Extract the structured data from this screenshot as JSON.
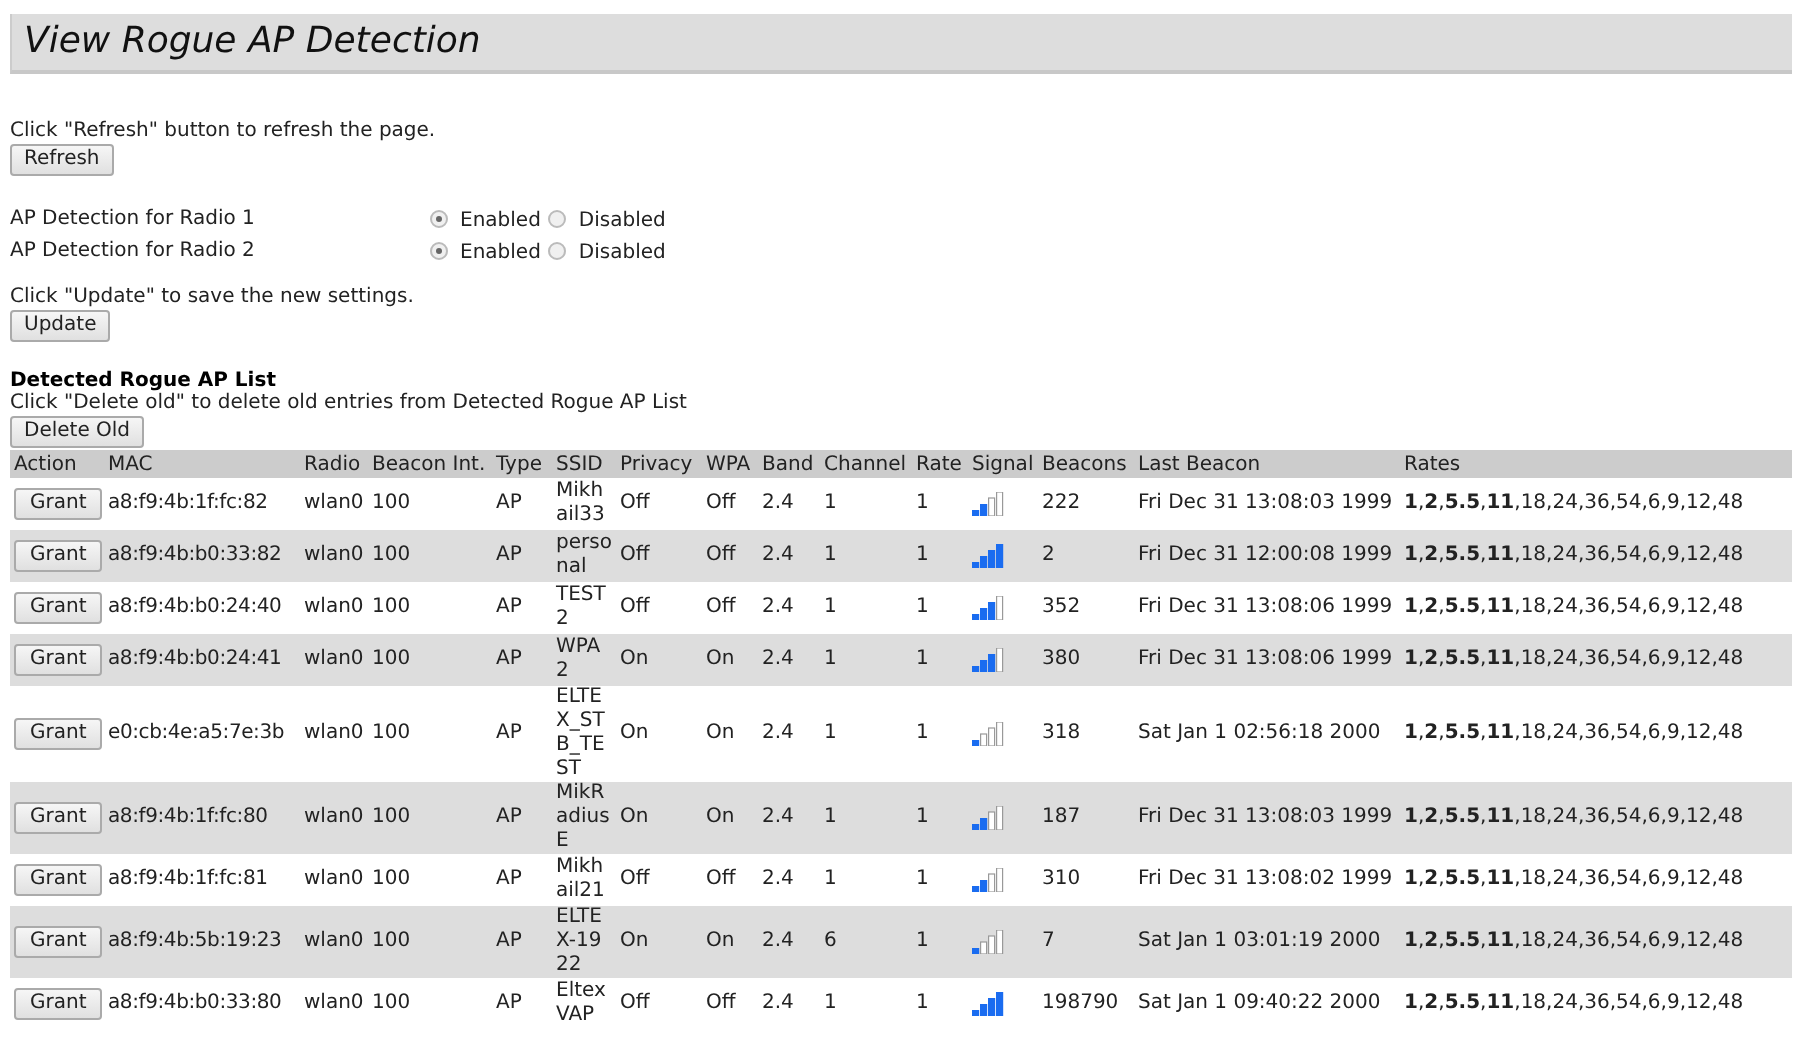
{
  "title": "View Rogue AP Detection",
  "refresh_hint": "Click \"Refresh\" button to refresh the page.",
  "refresh_button": "Refresh",
  "detection": [
    {
      "label": "AP Detection for Radio 1",
      "options": [
        {
          "label": "Enabled",
          "selected": true
        },
        {
          "label": "Disabled",
          "selected": false
        }
      ]
    },
    {
      "label": "AP Detection for Radio 2",
      "options": [
        {
          "label": "Enabled",
          "selected": true
        },
        {
          "label": "Disabled",
          "selected": false
        }
      ]
    }
  ],
  "update_hint": "Click \"Update\" to save the new settings.",
  "update_button": "Update",
  "list_title": "Detected Rogue AP List",
  "delete_hint": "Click \"Delete old\" to delete old entries from Detected Rogue AP List",
  "delete_button": "Delete Old",
  "table": {
    "columns": [
      "Action",
      "MAC",
      "Radio",
      "Beacon Int.",
      "Type",
      "SSID",
      "Privacy",
      "WPA",
      "Band",
      "Channel",
      "Rate",
      "Signal",
      "Beacons",
      "Last Beacon",
      "Rates"
    ],
    "rows": [
      {
        "action": "Grant",
        "mac": "a8:f9:4b:1f:fc:82",
        "radio": "wlan0",
        "beacon_int": "100",
        "type": "AP",
        "ssid": "Mikhail33",
        "privacy": "Off",
        "wpa": "Off",
        "band": "2.4",
        "channel": "1",
        "rate": "1",
        "signal": {
          "level": 0.5
        },
        "beacons": "222",
        "last_beacon": "Fri Dec 31 13:08:03 1999",
        "rates": "**1**,**2**,**5.5**,**11**,18,24,36,54,6,9,12,48"
      },
      {
        "action": "Grant",
        "mac": "a8:f9:4b:b0:33:82",
        "radio": "wlan0",
        "beacon_int": "100",
        "type": "AP",
        "ssid": "personal",
        "privacy": "Off",
        "wpa": "Off",
        "band": "2.4",
        "channel": "1",
        "rate": "1",
        "signal": {
          "level": 1
        },
        "beacons": "2",
        "last_beacon": "Fri Dec 31 12:00:08 1999",
        "rates": "**1**,**2**,**5.5**,**11**,18,24,36,54,6,9,12,48"
      },
      {
        "action": "Grant",
        "mac": "a8:f9:4b:b0:24:40",
        "radio": "wlan0",
        "beacon_int": "100",
        "type": "AP",
        "ssid": "TEST2",
        "privacy": "Off",
        "wpa": "Off",
        "band": "2.4",
        "channel": "1",
        "rate": "1",
        "signal": {
          "level": 0.75
        },
        "beacons": "352",
        "last_beacon": "Fri Dec 31 13:08:06 1999",
        "rates": "**1**,**2**,**5.5**,**11**,18,24,36,54,6,9,12,48"
      },
      {
        "action": "Grant",
        "mac": "a8:f9:4b:b0:24:41",
        "radio": "wlan0",
        "beacon_int": "100",
        "type": "AP",
        "ssid": "WPA2",
        "privacy": "On",
        "wpa": "On",
        "band": "2.4",
        "channel": "1",
        "rate": "1",
        "signal": {
          "level": 0.75
        },
        "beacons": "380",
        "last_beacon": "Fri Dec 31 13:08:06 1999",
        "rates": "**1**,**2**,**5.5**,**11**,18,24,36,54,6,9,12,48"
      },
      {
        "action": "Grant",
        "mac": "e0:cb:4e:a5:7e:3b",
        "radio": "wlan0",
        "beacon_int": "100",
        "type": "AP",
        "ssid": "ELTEX_STB_TEST",
        "privacy": "On",
        "wpa": "On",
        "band": "2.4",
        "channel": "1",
        "rate": "1",
        "signal": {
          "level": 0.25
        },
        "beacons": "318",
        "last_beacon": "Sat Jan 1 02:56:18 2000",
        "rates": "**1**,**2**,**5.5**,**11**,18,24,36,54,6,9,12,48"
      },
      {
        "action": "Grant",
        "mac": "a8:f9:4b:1f:fc:80",
        "radio": "wlan0",
        "beacon_int": "100",
        "type": "AP",
        "ssid": "MikRadiusE",
        "privacy": "On",
        "wpa": "On",
        "band": "2.4",
        "channel": "1",
        "rate": "1",
        "signal": {
          "level": 0.5
        },
        "beacons": "187",
        "last_beacon": "Fri Dec 31 13:08:03 1999",
        "rates": "**1**,**2**,**5.5**,**11**,18,24,36,54,6,9,12,48"
      },
      {
        "action": "Grant",
        "mac": "a8:f9:4b:1f:fc:81",
        "radio": "wlan0",
        "beacon_int": "100",
        "type": "AP",
        "ssid": "Mikhail21",
        "privacy": "Off",
        "wpa": "Off",
        "band": "2.4",
        "channel": "1",
        "rate": "1",
        "signal": {
          "level": 0.5
        },
        "beacons": "310",
        "last_beacon": "Fri Dec 31 13:08:02 1999",
        "rates": "**1**,**2**,**5.5**,**11**,18,24,36,54,6,9,12,48"
      },
      {
        "action": "Grant",
        "mac": "a8:f9:4b:5b:19:23",
        "radio": "wlan0",
        "beacon_int": "100",
        "type": "AP",
        "ssid": "ELTEX-1922",
        "privacy": "On",
        "wpa": "On",
        "band": "2.4",
        "channel": "6",
        "rate": "1",
        "signal": {
          "level": 0.25
        },
        "beacons": "7",
        "last_beacon": "Sat Jan 1 03:01:19 2000",
        "rates": "**1**,**2**,**5.5**,**11**,18,24,36,54,6,9,12,48"
      },
      {
        "action": "Grant",
        "mac": "a8:f9:4b:b0:33:80",
        "radio": "wlan0",
        "beacon_int": "100",
        "type": "AP",
        "ssid": "Eltex VAP",
        "privacy": "Off",
        "wpa": "Off",
        "band": "2.4",
        "channel": "1",
        "rate": "1",
        "signal": {
          "level": 1
        },
        "beacons": "198790",
        "last_beacon": "Sat Jan 1 09:40:22 2000",
        "rates": "**1**,**2**,**5.5**,**11**,18,24,36,54,6,9,12,48"
      }
    ]
  }
}
